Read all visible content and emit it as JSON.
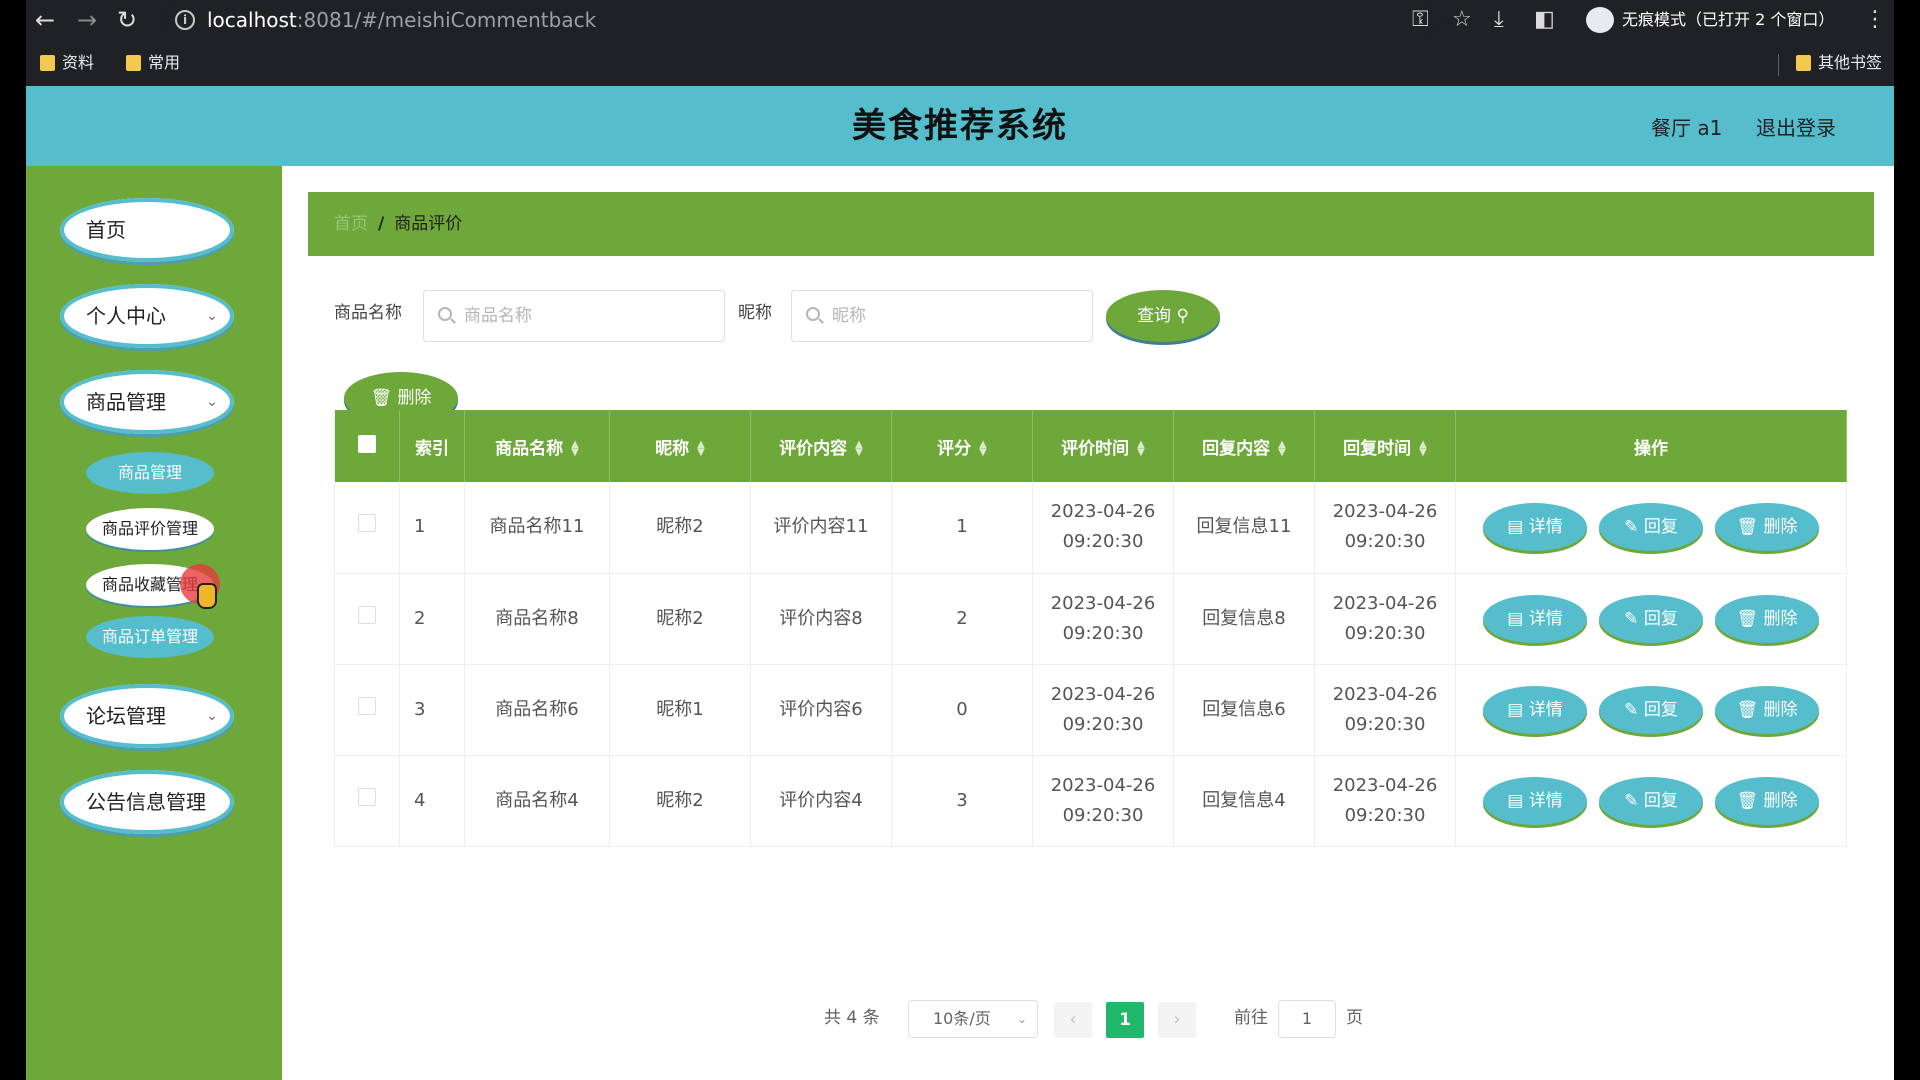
{
  "browser": {
    "url_host": "localhost",
    "url_path": ":8081/#/meishiCommentback",
    "incognito_label": "无痕模式（已打开 2 个窗口）",
    "bookmarks": [
      "资料",
      "常用"
    ],
    "other_bookmarks": "其他书签"
  },
  "header": {
    "title": "美食推荐系统",
    "user": "餐厅 a1",
    "logout": "退出登录"
  },
  "sidebar": {
    "home": "首页",
    "profile": "个人中心",
    "goods_mgmt": "商品管理",
    "sub": [
      "商品管理",
      "商品评价管理",
      "商品收藏管理",
      "商品订单管理"
    ],
    "forum": "论坛管理",
    "notice": "公告信息管理"
  },
  "breadcrumb": {
    "home": "首页",
    "separator": "/",
    "current": "商品评价"
  },
  "search": {
    "name_label": "商品名称",
    "name_placeholder": "商品名称",
    "nick_label": "昵称",
    "nick_placeholder": "昵称",
    "query_btn": "查询"
  },
  "delete_btn": "删除",
  "table": {
    "headers": [
      "索引",
      "商品名称",
      "昵称",
      "评价内容",
      "评分",
      "评价时间",
      "回复内容",
      "回复时间",
      "操作"
    ],
    "rows": [
      {
        "idx": "1",
        "name": "商品名称11",
        "nick": "昵称2",
        "content": "评价内容11",
        "score": "1",
        "time_d": "2023-04-26",
        "time_t": "09:20:30",
        "reply": "回复信息11",
        "rtime_d": "2023-04-26",
        "rtime_t": "09:20:30"
      },
      {
        "idx": "2",
        "name": "商品名称8",
        "nick": "昵称2",
        "content": "评价内容8",
        "score": "2",
        "time_d": "2023-04-26",
        "time_t": "09:20:30",
        "reply": "回复信息8",
        "rtime_d": "2023-04-26",
        "rtime_t": "09:20:30"
      },
      {
        "idx": "3",
        "name": "商品名称6",
        "nick": "昵称1",
        "content": "评价内容6",
        "score": "0",
        "time_d": "2023-04-26",
        "time_t": "09:20:30",
        "reply": "回复信息6",
        "rtime_d": "2023-04-26",
        "rtime_t": "09:20:30"
      },
      {
        "idx": "4",
        "name": "商品名称4",
        "nick": "昵称2",
        "content": "评价内容4",
        "score": "3",
        "time_d": "2023-04-26",
        "time_t": "09:20:30",
        "reply": "回复信息4",
        "rtime_d": "2023-04-26",
        "rtime_t": "09:20:30"
      }
    ],
    "actions": {
      "detail": "详情",
      "reply": "回复",
      "delete": "删除"
    }
  },
  "pagination": {
    "total": "共 4 条",
    "page_size": "10条/页",
    "current_page": "1",
    "goto_label": "前往",
    "goto_value": "1",
    "page_unit": "页"
  }
}
